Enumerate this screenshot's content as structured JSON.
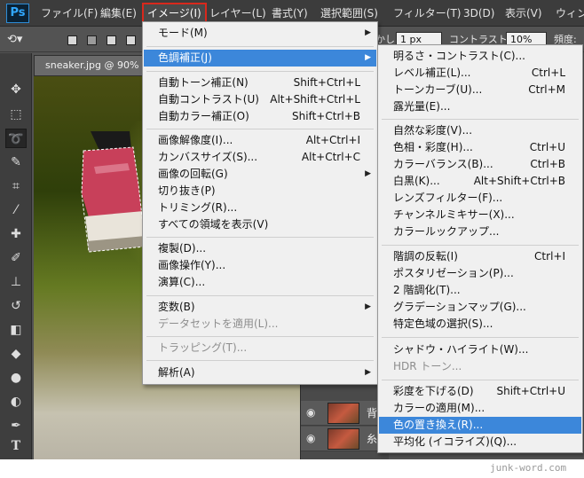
{
  "app": {
    "logo": "Ps",
    "colors": {
      "menubar": "#3c3c3c",
      "accent_highlight": "#3c87da",
      "active_menu_outline": "#d9281c",
      "panel": "#535353"
    }
  },
  "menubar": {
    "items": [
      {
        "label": "ファイル(F)"
      },
      {
        "label": "編集(E)"
      },
      {
        "label": "イメージ(I)",
        "active": true
      },
      {
        "label": "レイヤー(L)"
      },
      {
        "label": "書式(Y)"
      },
      {
        "label": "選択範囲(S)"
      },
      {
        "label": "フィルター(T)"
      },
      {
        "label": "3D(D)"
      },
      {
        "label": "表示(V)"
      },
      {
        "label": "ウィンドウ"
      }
    ]
  },
  "options": {
    "feather_label": "ぼかし",
    "feather_value": "1 px",
    "contrast_label": "コントラスト:",
    "contrast_value": "10%",
    "frequency_label": "頻度:"
  },
  "document": {
    "tab": "sneaker.jpg @ 90% ("
  },
  "layers": {
    "rows": [
      {
        "name": "背"
      },
      {
        "name": "糸"
      }
    ]
  },
  "image_menu": {
    "items": [
      {
        "label": "モード(M)",
        "submenu": true
      },
      {
        "label": "色調補正(J)",
        "submenu": true,
        "highlighted": true
      },
      {
        "label": "自動トーン補正(N)",
        "shortcut": "Shift+Ctrl+L"
      },
      {
        "label": "自動コントラスト(U)",
        "shortcut": "Alt+Shift+Ctrl+L"
      },
      {
        "label": "自動カラー補正(O)",
        "shortcut": "Shift+Ctrl+B"
      },
      {
        "label": "画像解像度(I)...",
        "shortcut": "Alt+Ctrl+I"
      },
      {
        "label": "カンバスサイズ(S)...",
        "shortcut": "Alt+Ctrl+C"
      },
      {
        "label": "画像の回転(G)",
        "submenu": true
      },
      {
        "label": "切り抜き(P)"
      },
      {
        "label": "トリミング(R)..."
      },
      {
        "label": "すべての領域を表示(V)"
      },
      {
        "label": "複製(D)..."
      },
      {
        "label": "画像操作(Y)..."
      },
      {
        "label": "演算(C)..."
      },
      {
        "label": "変数(B)",
        "submenu": true
      },
      {
        "label": "データセットを適用(L)...",
        "disabled": true
      },
      {
        "label": "トラッピング(T)...",
        "disabled": true
      },
      {
        "label": "解析(A)",
        "submenu": true
      }
    ]
  },
  "adjust_menu": {
    "items": [
      {
        "label": "明るさ・コントラスト(C)..."
      },
      {
        "label": "レベル補正(L)...",
        "shortcut": "Ctrl+L"
      },
      {
        "label": "トーンカーブ(U)...",
        "shortcut": "Ctrl+M"
      },
      {
        "label": "露光量(E)..."
      },
      {
        "label": "自然な彩度(V)..."
      },
      {
        "label": "色相・彩度(H)...",
        "shortcut": "Ctrl+U"
      },
      {
        "label": "カラーバランス(B)...",
        "shortcut": "Ctrl+B"
      },
      {
        "label": "白黒(K)...",
        "shortcut": "Alt+Shift+Ctrl+B"
      },
      {
        "label": "レンズフィルター(F)..."
      },
      {
        "label": "チャンネルミキサー(X)..."
      },
      {
        "label": "カラールックアップ..."
      },
      {
        "label": "階調の反転(I)",
        "shortcut": "Ctrl+I"
      },
      {
        "label": "ポスタリゼーション(P)..."
      },
      {
        "label": "2 階調化(T)..."
      },
      {
        "label": "グラデーションマップ(G)..."
      },
      {
        "label": "特定色域の選択(S)..."
      },
      {
        "label": "シャドウ・ハイライト(W)..."
      },
      {
        "label": "HDR トーン...",
        "disabled": true
      },
      {
        "label": "彩度を下げる(D)",
        "shortcut": "Shift+Ctrl+U"
      },
      {
        "label": "カラーの適用(M)..."
      },
      {
        "label": "色の置き換え(R)...",
        "highlighted": true
      },
      {
        "label": "平均化 (イコライズ)(Q)..."
      }
    ]
  },
  "watermark": "junk-word.com"
}
